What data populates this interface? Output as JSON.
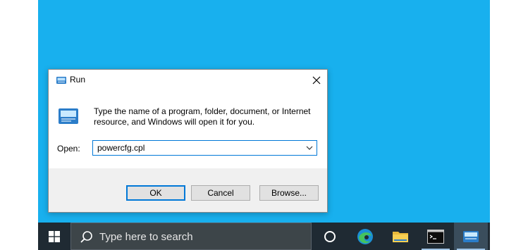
{
  "dialog": {
    "title": "Run",
    "description": "Type the name of a program, folder, document, or Internet resource, and Windows will open it for you.",
    "open_label": "Open:",
    "open_value": "powercfg.cpl",
    "buttons": {
      "ok": "OK",
      "cancel": "Cancel",
      "browse": "Browse..."
    },
    "icons": {
      "title": "run-icon",
      "close": "close-icon",
      "dropdown": "chevron-down-icon"
    }
  },
  "taskbar": {
    "search_placeholder": "Type here to search",
    "items": [
      "windows-start",
      "cortana",
      "edge",
      "file-explorer",
      "command-prompt",
      "run"
    ],
    "colors": {
      "taskbar": "#1f2a33",
      "search": "#3d4549",
      "desktop": "#18b0ee",
      "accent": "#0078d7"
    }
  }
}
